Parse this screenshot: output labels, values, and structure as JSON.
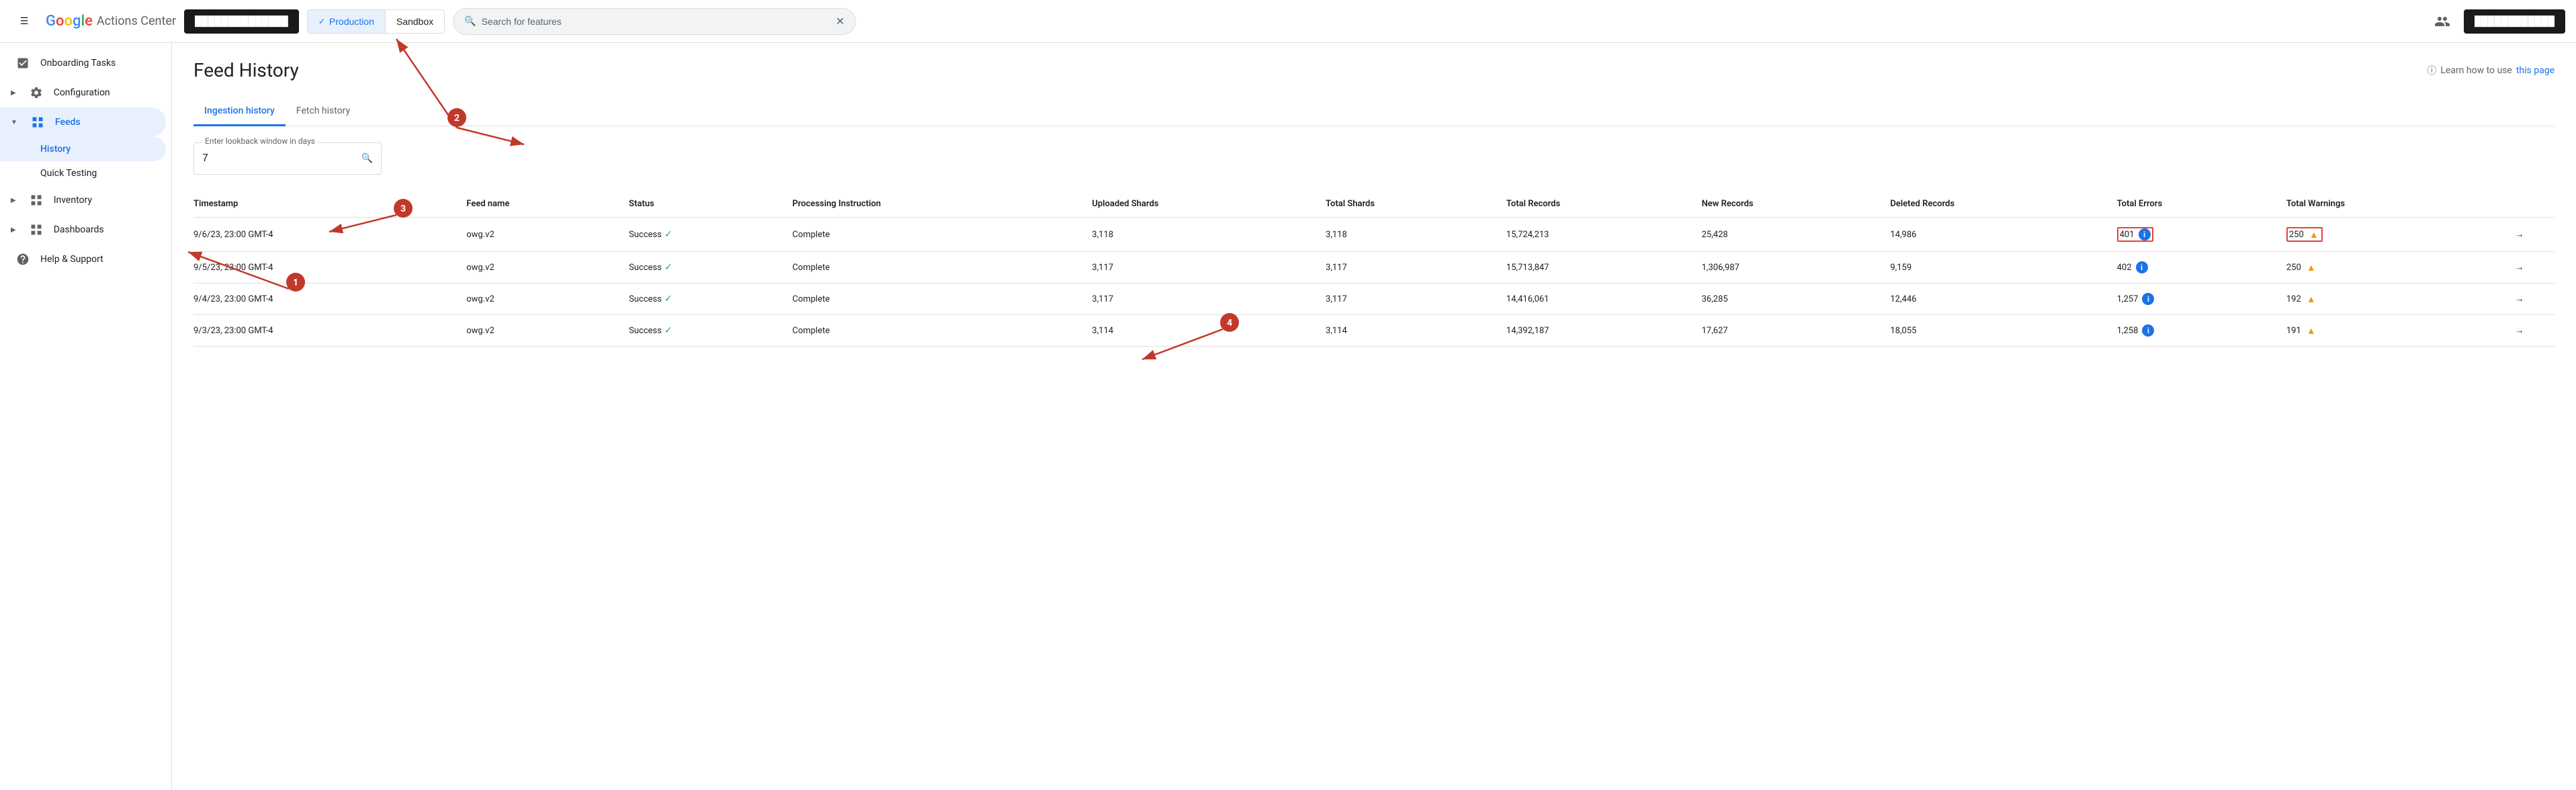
{
  "app": {
    "menu_icon": "☰",
    "logo_g": "G",
    "logo_o1": "o",
    "logo_o2": "o",
    "logo_g2": "g",
    "logo_l": "l",
    "logo_e": "e",
    "app_name": "Actions Center"
  },
  "navbar": {
    "account_placeholder": "██████████████",
    "user_placeholder": "████████████",
    "search_placeholder": "Search for features",
    "search_clear": "✕",
    "production_label": "Production",
    "sandbox_label": "Sandbox",
    "production_check": "✓"
  },
  "sidebar": {
    "items": [
      {
        "id": "onboarding",
        "label": "Onboarding Tasks",
        "icon": "☑",
        "expandable": false,
        "active": false
      },
      {
        "id": "configuration",
        "label": "Configuration",
        "icon": "⚙",
        "expandable": true,
        "active": false
      },
      {
        "id": "feeds",
        "label": "Feeds",
        "icon": "⊞",
        "expandable": true,
        "active": true
      },
      {
        "id": "inventory",
        "label": "Inventory",
        "icon": "⊞",
        "expandable": true,
        "active": false
      },
      {
        "id": "dashboards",
        "label": "Dashboards",
        "icon": "⊞",
        "expandable": true,
        "active": false
      },
      {
        "id": "help",
        "label": "Help & Support",
        "icon": "?",
        "expandable": false,
        "active": false
      }
    ],
    "sub_items": [
      {
        "id": "history",
        "label": "History",
        "active": true
      },
      {
        "id": "quick-testing",
        "label": "Quick Testing",
        "active": false
      }
    ]
  },
  "page": {
    "title": "Feed History",
    "help_label": "Learn how to use",
    "help_link_text": "this page"
  },
  "tabs": [
    {
      "id": "ingestion",
      "label": "Ingestion history",
      "active": true
    },
    {
      "id": "fetch",
      "label": "Fetch history",
      "active": false
    }
  ],
  "search": {
    "label": "Enter lookback window in days",
    "value": "7",
    "placeholder": ""
  },
  "table": {
    "columns": [
      "Timestamp",
      "Feed name",
      "Status",
      "Processing Instruction",
      "Uploaded Shards",
      "Total Shards",
      "Total Records",
      "New Records",
      "Deleted Records",
      "Total Errors",
      "Total Warnings"
    ],
    "rows": [
      {
        "timestamp": "9/6/23, 23:00 GMT-4",
        "feed_name": "owg.v2",
        "status": "Success",
        "processing": "Complete",
        "uploaded_shards": "3,118",
        "total_shards": "3,118",
        "total_records": "15,724,213",
        "new_records": "25,428",
        "deleted_records": "14,986",
        "total_errors": "401",
        "total_warnings": "250",
        "highlighted": true
      },
      {
        "timestamp": "9/5/23, 23:00 GMT-4",
        "feed_name": "owg.v2",
        "status": "Success",
        "processing": "Complete",
        "uploaded_shards": "3,117",
        "total_shards": "3,117",
        "total_records": "15,713,847",
        "new_records": "1,306,987",
        "deleted_records": "9,159",
        "total_errors": "402",
        "total_warnings": "250",
        "highlighted": false
      },
      {
        "timestamp": "9/4/23, 23:00 GMT-4",
        "feed_name": "owg.v2",
        "status": "Success",
        "processing": "Complete",
        "uploaded_shards": "3,117",
        "total_shards": "3,117",
        "total_records": "14,416,061",
        "new_records": "36,285",
        "deleted_records": "12,446",
        "total_errors": "1,257",
        "total_warnings": "192",
        "highlighted": false
      },
      {
        "timestamp": "9/3/23, 23:00 GMT-4",
        "feed_name": "owg.v2",
        "status": "Success",
        "processing": "Complete",
        "uploaded_shards": "3,114",
        "total_shards": "3,114",
        "total_records": "14,392,187",
        "new_records": "17,627",
        "deleted_records": "18,055",
        "total_errors": "1,258",
        "total_warnings": "191",
        "highlighted": false
      }
    ]
  },
  "annotations": {
    "label_1": "1",
    "label_2": "2",
    "label_3": "3",
    "label_4": "4"
  }
}
